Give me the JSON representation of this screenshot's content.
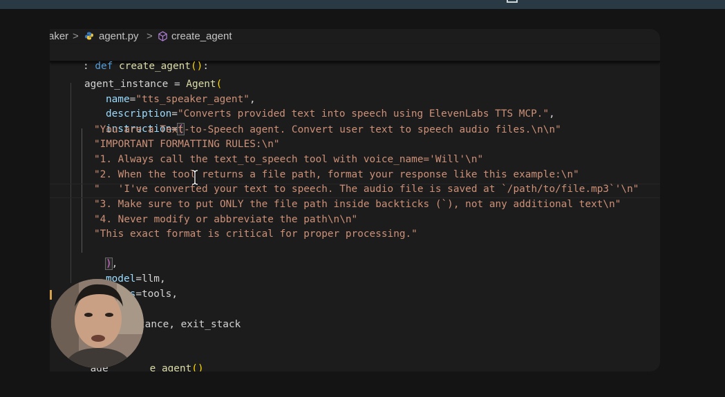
{
  "breadcrumb": {
    "folder": "aker",
    "sep": ">",
    "file": "agent.py",
    "symbol": "create_agent",
    "file_icon": "python-file-icon",
    "symbol_icon": "method-cube-icon"
  },
  "sticky": {
    "prefix": ":",
    "keyword": "def",
    "name": "create_agent",
    "open": "(",
    "close": ")",
    "colon": ":"
  },
  "code": {
    "l1": {
      "text": "agent_instance = ",
      "call": "Agent",
      "open": "("
    },
    "l2": {
      "param": "name",
      "eq": "=",
      "value": "\"tts_speaker_agent\"",
      "comma": ","
    },
    "l3": {
      "param": "description",
      "eq": "=",
      "value": "\"Converts provided text into speech using ElevenLabs TTS MCP.\"",
      "comma": ","
    },
    "l4": {
      "param": "instruction",
      "eq": "=",
      "open": "("
    },
    "l5": "\"You are a Text-to-Speech agent. Convert user text to speech audio files.\\n\\n\"",
    "l6": "\"IMPORTANT FORMATTING RULES:\\n\"",
    "l7": "\"1. Always call the text_to_speech tool with voice_name='Will'\\n\"",
    "l8": "\"2. When the tool returns a file path, format your response like this example:\\n\"",
    "l9": "\"   'I've converted your text to speech. The audio file is saved at `/path/to/file.mp3`'\\n\"",
    "l10": "\"3. Make sure to put ONLY the file path inside backticks (`), not any additional text\\n\"",
    "l11": "\"4. Never modify or abbreviate the path\\n\\n\"",
    "l12": "\"This exact format is critical for proper processing.\"",
    "l13": {
      "close": ")",
      "comma": ","
    },
    "l14": {
      "param": "model",
      "eq": "=",
      "value": "llm",
      "comma": ","
    },
    "l15": {
      "param": "tools",
      "eq": "=",
      "value": "tools",
      "comma": ","
    },
    "l16": "tance, exit_stack",
    "l17": {
      "pre": "_age",
      "post": "e_agent",
      "parens": "()"
    }
  },
  "colors": {
    "keyword": "#569cd6",
    "function": "#dcdcaa",
    "string": "#ce9178",
    "parameter": "#9cdcfe",
    "bracket_gold": "#ffd700",
    "bracket_violet": "#da70d6"
  },
  "overlay": {
    "webcam": "presenter-webcam",
    "cursor": "text-cursor-ibeam-icon"
  }
}
